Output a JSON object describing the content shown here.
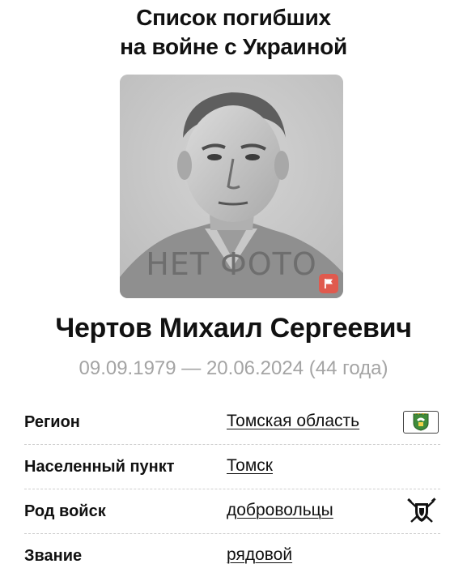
{
  "header": {
    "title_line1": "Список погибших",
    "title_line2": "на войне с Украиной"
  },
  "photo": {
    "placeholder_text": "НЕТ ФОТО",
    "report_icon": "flag-icon",
    "report_color": "#e05a4e"
  },
  "person": {
    "name": "Чертов Михаил Сергеевич",
    "dates": "09.09.1979 — 20.06.2024 (44 года)"
  },
  "info": {
    "rows": [
      {
        "label": "Регион",
        "value": "Томская область",
        "icon": "region-coat-of-arms-icon"
      },
      {
        "label": "Населенный пункт",
        "value": "Томск"
      },
      {
        "label": "Род войск",
        "value": "добровольцы",
        "icon": "volunteers-emblem-icon"
      },
      {
        "label": "Звание",
        "value": "рядовой"
      }
    ]
  },
  "colors": {
    "dates_gray": "#a4a4a4",
    "text": "#111111",
    "divider": "#cfcfcf",
    "emblem_green": "#3f8b3a"
  }
}
